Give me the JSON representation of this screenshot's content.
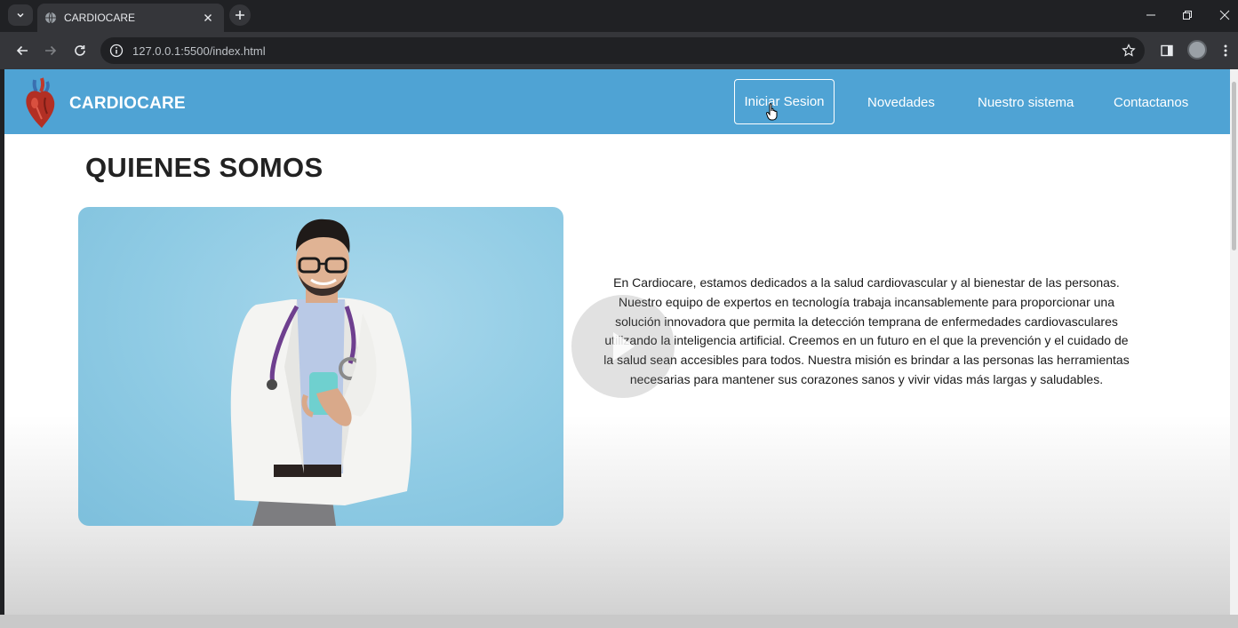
{
  "browser": {
    "tab_title": "CARDIOCARE",
    "url": "127.0.0.1:5500/index.html"
  },
  "site": {
    "brand": "CARDIOCARE",
    "nav": {
      "login": "Iniciar Sesion",
      "news": "Novedades",
      "system": "Nuestro sistema",
      "contact": "Contactanos"
    }
  },
  "about": {
    "title": "QUIENES SOMOS",
    "body": "En Cardiocare, estamos dedicados a la salud cardiovascular y al bienestar de las personas. Nuestro equipo de expertos en tecnología trabaja incansablemente para proporcionar una solución innovadora que permita la detección temprana de enfermedades cardiovasculares utilizando la inteligencia artificial. Creemos en un futuro en el que la prevención y el cuidado de la salud sean accesibles para todos. Nuestra misión es brindar a las personas las herramientas necesarias para mantener sus corazones sanos y vivir vidas más largas y saludables."
  },
  "colors": {
    "navbar": "#4fa3d4",
    "chrome_dark": "#202124",
    "chrome_toolbar": "#35363a"
  }
}
